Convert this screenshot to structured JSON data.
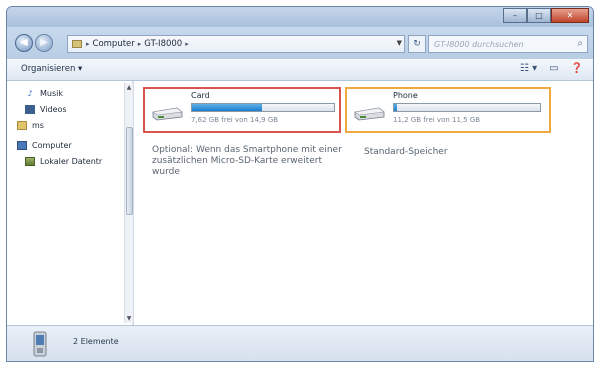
{
  "window": {
    "buttons": {
      "minimize": "–",
      "maximize": "□",
      "close": "✕"
    }
  },
  "navigation": {
    "back": "◀",
    "forward": "▶",
    "breadcrumbs": [
      "Computer",
      "GT-I8000"
    ],
    "refresh": "↻",
    "search_placeholder": "GT-I8000 durchsuchen",
    "search_icon": "search-icon"
  },
  "toolbar": {
    "organize_label": "Organisieren ▾",
    "icons": [
      "view-options-icon",
      "preview-pane-icon",
      "help-icon"
    ]
  },
  "sidebar": {
    "items": [
      {
        "label": "Musik",
        "icon": "music-icon"
      },
      {
        "label": "Videos",
        "icon": "video-icon"
      },
      {
        "label": "ms",
        "icon": "user-icon"
      },
      {
        "label": "Computer",
        "icon": "computer-icon"
      },
      {
        "label": "Lokaler Datentr",
        "icon": "local-disk-icon"
      }
    ]
  },
  "drives": {
    "card": {
      "name": "Card",
      "free_text": "7,62 GB frei von 14,9 GB",
      "used_fraction": 0.49,
      "highlight_color": "#d9544f",
      "note": "Optional: Wenn das Smartphone mit einer zusätzlichen Micro-SD-Karte erweitert wurde"
    },
    "phone": {
      "name": "Phone",
      "free_text": "11,2 GB frei von 11,5 GB",
      "used_fraction": 0.02,
      "highlight_color": "#f0a840",
      "note": "Standard-Speicher"
    }
  },
  "status": {
    "text": "2 Elemente"
  }
}
